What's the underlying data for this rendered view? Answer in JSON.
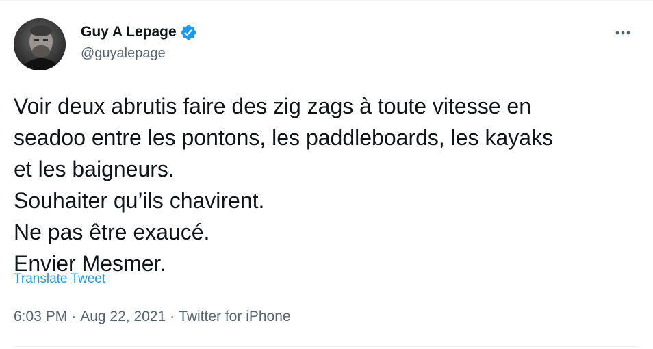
{
  "author": {
    "display_name": "Guy A Lepage",
    "handle": "@guyalepage",
    "verified": true,
    "verified_badge_color": "#1d9bf0",
    "avatar_icon": "profile-photo"
  },
  "menu": {
    "more_icon": "more-dots-icon"
  },
  "tweet": {
    "lines": [
      "Voir deux abrutis faire des zig zags à toute vitesse en",
      "seadoo entre les pontons, les paddleboards, les kayaks",
      "et les baigneurs.",
      "Souhaiter qu’ils chavirent.",
      "Ne pas être exaucé.",
      "Envier Mesmer."
    ],
    "translate_label": "Translate Tweet"
  },
  "meta": {
    "time": "6:03 PM",
    "date": "Aug 22, 2021",
    "separator": "·",
    "source": "Twitter for iPhone"
  },
  "colors": {
    "text_primary": "#0f1419",
    "text_secondary": "#536471",
    "link": "#1d9bf0"
  }
}
